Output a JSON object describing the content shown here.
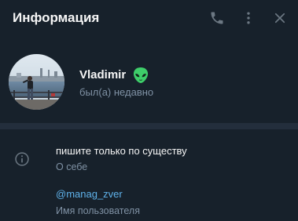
{
  "header": {
    "title": "Информация",
    "icons": [
      "phone-icon",
      "more-vertical-icon",
      "close-icon"
    ]
  },
  "profile": {
    "name": "Vladimir",
    "emoji": "alien-icon",
    "status": "был(а) недавно"
  },
  "info": {
    "bio": "пишите только по существу",
    "bio_label": "О себе",
    "username": "@manag_zver",
    "username_label": "Имя пользователя"
  },
  "colors": {
    "background": "#17212b",
    "divider": "#232e3c",
    "secondary_text": "#7f91a4",
    "link": "#5fb2ea",
    "icon": "#6c7883"
  }
}
